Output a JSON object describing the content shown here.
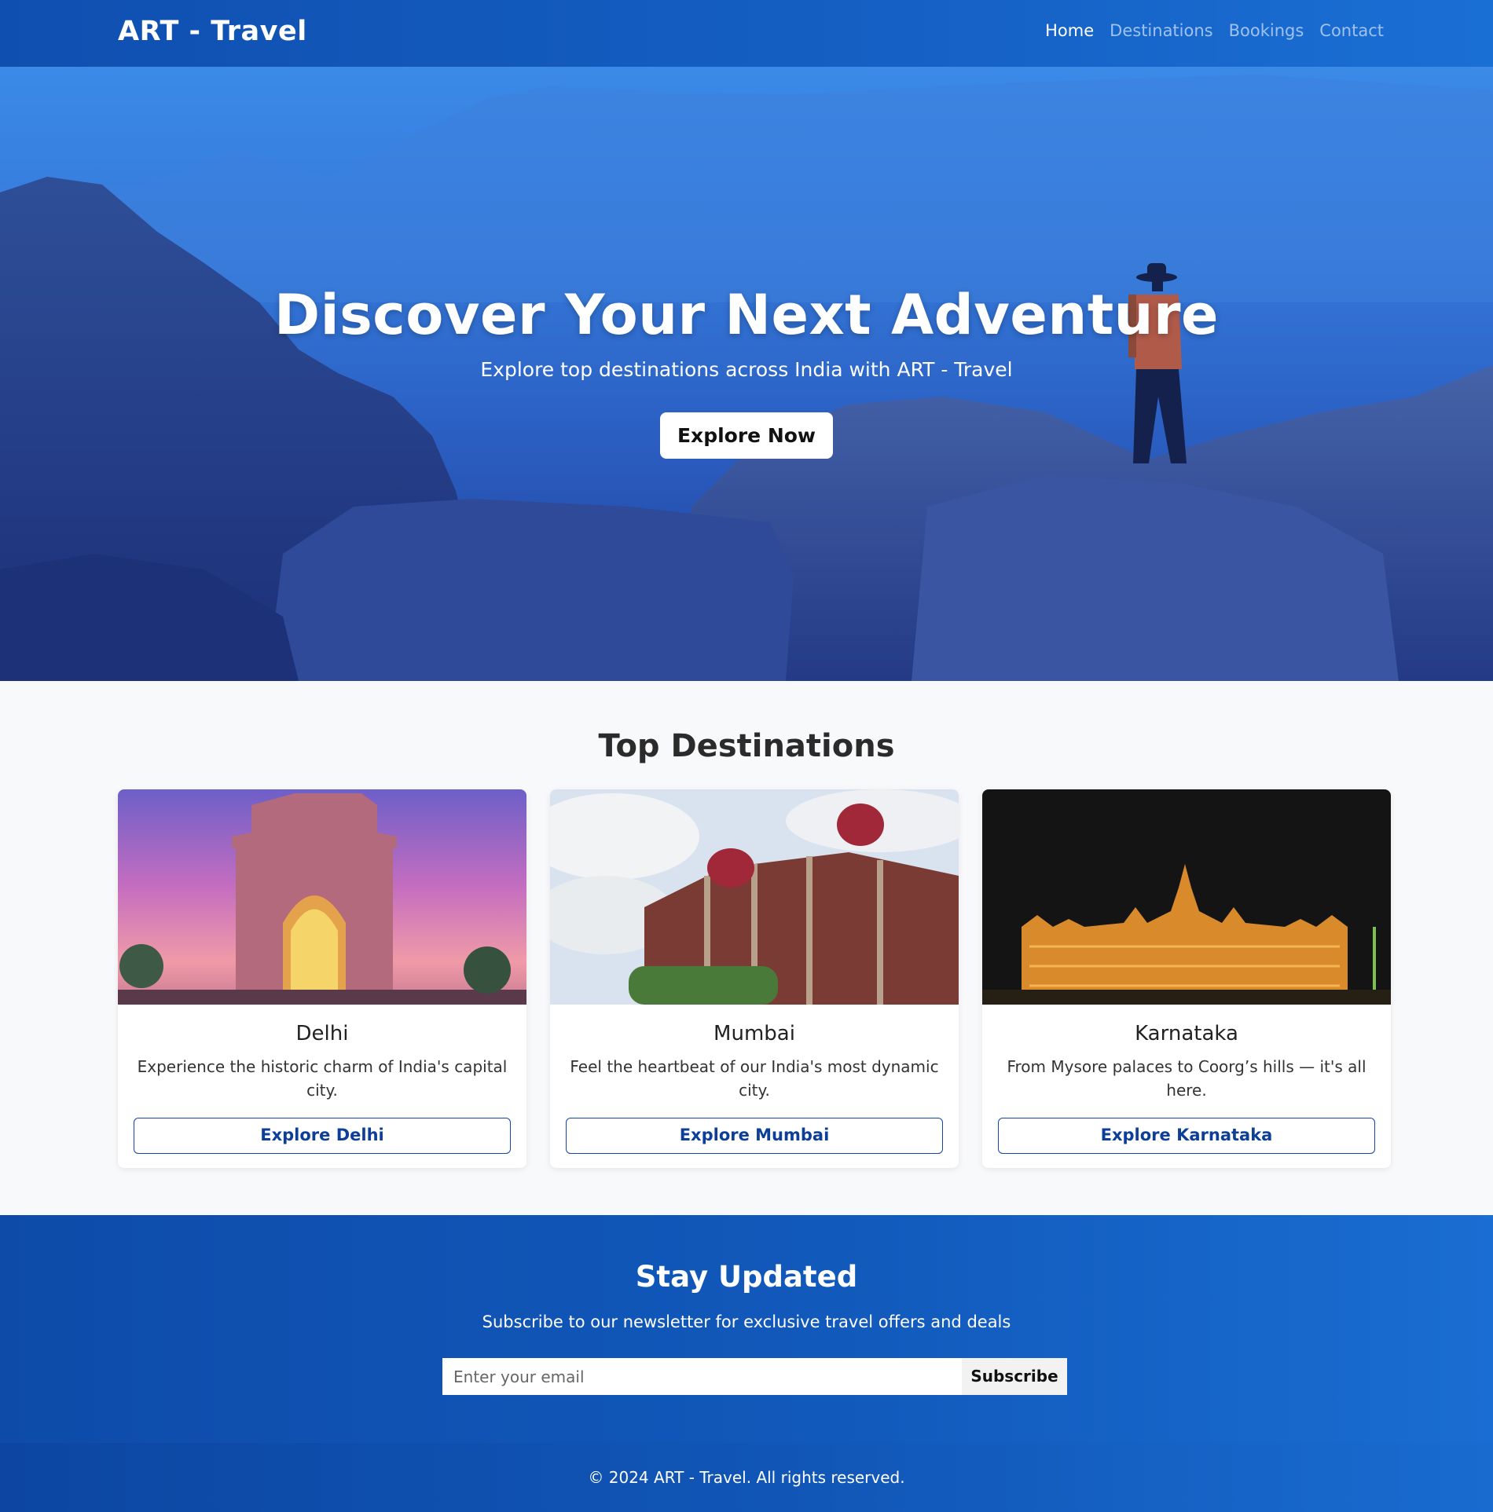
{
  "brand": "ART - Travel",
  "nav": {
    "home": "Home",
    "destinations": "Destinations",
    "bookings": "Bookings",
    "contact": "Contact"
  },
  "hero": {
    "title": "Discover Your Next Adventure",
    "subtitle": "Explore top destinations across India with ART - Travel",
    "cta": "Explore Now"
  },
  "destinations": {
    "title": "Top Destinations",
    "cards": [
      {
        "name": "Delhi",
        "text": "Experience the historic charm of India's capital city.",
        "button": "Explore Delhi"
      },
      {
        "name": "Mumbai",
        "text": "Feel the heartbeat of our India's most dynamic city.",
        "button": "Explore Mumbai"
      },
      {
        "name": "Karnataka",
        "text": "From Mysore palaces to Coorg’s hills — it's all here.",
        "button": "Explore Karnataka"
      }
    ]
  },
  "newsletter": {
    "title": "Stay Updated",
    "text": "Subscribe to our newsletter for exclusive travel offers and deals",
    "placeholder": "Enter your email",
    "button": "Subscribe"
  },
  "footer": {
    "text": "© 2024 ART - Travel. All rights reserved."
  },
  "colors": {
    "primary": "#1560c4",
    "button_outline": "#1246a3"
  }
}
